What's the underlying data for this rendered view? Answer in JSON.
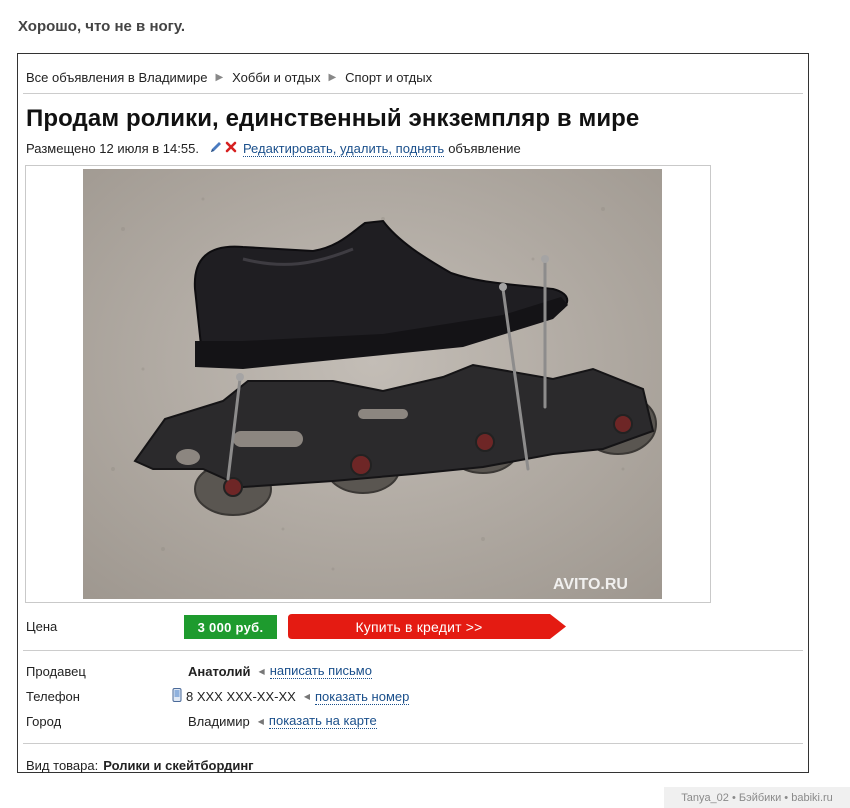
{
  "post": {
    "caption": "Хорошо, что не в ногу."
  },
  "breadcrumb": [
    "Все объявления в Владимире",
    "Хобби и отдых",
    "Спорт и отдых"
  ],
  "ad": {
    "title": "Продам ролики, единственный энкземпляр в мире",
    "posted": "Размещено 12 июля в 14:55.",
    "edit_link": "Редактировать, удалить, поднять",
    "edit_suffix": "объявление",
    "watermark": "AVITO.RU"
  },
  "price": {
    "label": "Цена",
    "value": "3 000 руб.",
    "credit_button": "Купить в кредит >>"
  },
  "seller": {
    "label": "Продавец",
    "name": "Анатолий",
    "action": "написать письмо",
    "phone_label": "Телефон",
    "phone": "8 XXX XXX-XX-XX",
    "phone_action": "показать номер",
    "city_label": "Город",
    "city": "Владимир",
    "city_action": "показать на карте"
  },
  "item_type": {
    "label": "Вид товара:",
    "value": "Ролики и скейтбординг"
  },
  "footer": {
    "credit": "Tanya_02 • Бэйбики • babiki.ru"
  },
  "colors": {
    "price_bg": "#1e9b2e",
    "credit_bg": "#e41b12",
    "link": "#1a4f8b"
  },
  "icons": [
    "pencil-icon",
    "delete-icon",
    "phone-icon"
  ]
}
